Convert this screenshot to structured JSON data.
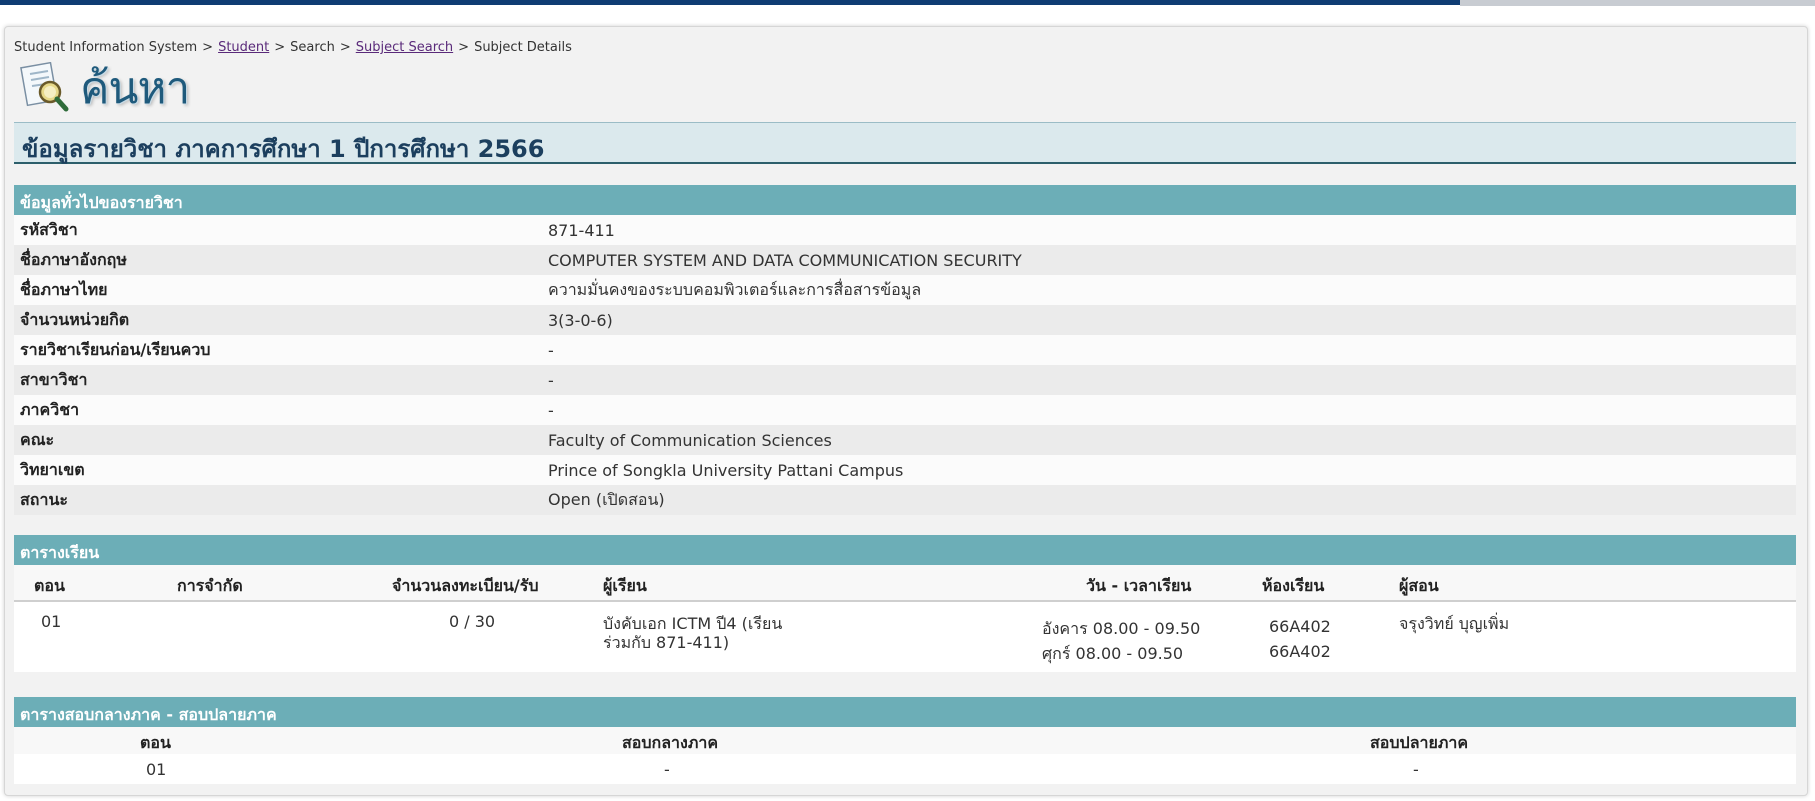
{
  "breadcrumb": {
    "items": [
      "Student Information System",
      "Student",
      "Search",
      "Subject Search",
      "Subject Details"
    ],
    "separator": ">"
  },
  "page": {
    "title": "ค้นหา",
    "icon": "search-document-icon"
  },
  "subject_header": "ข้อมูลรายวิชา ภาคการศึกษา 1 ปีการศึกษา 2566",
  "general": {
    "title": "ข้อมูลทั่วไปของรายวิชา",
    "rows": [
      {
        "label": "รหัสวิชา",
        "value": "871-411"
      },
      {
        "label": "ชื่อภาษาอังกฤษ",
        "value": "COMPUTER SYSTEM AND DATA COMMUNICATION SECURITY"
      },
      {
        "label": "ชื่อภาษาไทย",
        "value": "ความมั่นคงของระบบคอมพิวเตอร์และการสื่อสารข้อมูล"
      },
      {
        "label": "จำนวนหน่วยกิต",
        "value": "3(3-0-6)"
      },
      {
        "label": "รายวิชาเรียนก่อน/เรียนควบ",
        "value": "-"
      },
      {
        "label": "สาขาวิชา",
        "value": "-"
      },
      {
        "label": "ภาควิชา",
        "value": "-"
      },
      {
        "label": "คณะ",
        "value": "Faculty of Communication Sciences"
      },
      {
        "label": "วิทยาเขต",
        "value": "Prince of Songkla University Pattani Campus"
      },
      {
        "label": "สถานะ",
        "value": "Open (เปิดสอน)"
      }
    ]
  },
  "schedule": {
    "title": "ตารางเรียน",
    "headers": {
      "section": "ตอน",
      "restriction": "การจำกัด",
      "enrollment": "จำนวนลงทะเบียน/รับ",
      "learners": "ผู้เรียน",
      "time": "วัน - เวลาเรียน",
      "room": "ห้องเรียน",
      "instructor": "ผู้สอน"
    },
    "row": {
      "section": "01",
      "enrollment": "0 / 30",
      "learners_line1": "บังคับเอก ICTM ปี4 (เรียน",
      "learners_line2": "ร่วมกับ 871-411)",
      "time1": "อังคาร 08.00 - 09.50",
      "room1": "66A402",
      "time2": "ศุกร์ 08.00 - 09.50",
      "room2": "66A402",
      "instructor": "จรุงวิทย์ บุญเพิ่ม"
    }
  },
  "exam": {
    "title": "ตารางสอบกลางภาค - สอบปลายภาค",
    "headers": {
      "section": "ตอน",
      "midterm": "สอบกลางภาค",
      "final": "สอบปลายภาค"
    },
    "row": {
      "section": "01",
      "midterm": "-",
      "final": "-"
    }
  },
  "colors": {
    "section_bar": "#6caeb7",
    "header_bg": "#dbe9ed",
    "top_bar": "#0f3c73"
  }
}
